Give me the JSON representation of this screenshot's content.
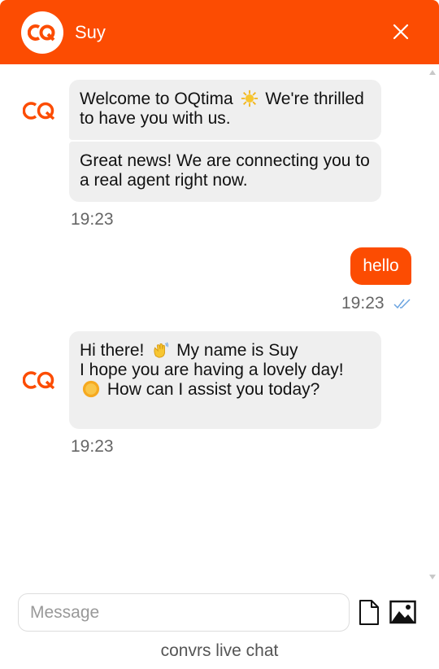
{
  "header": {
    "agent_name": "Suy",
    "brand_color": "#fc4c02"
  },
  "messages": {
    "m1": {
      "pre": "Welcome to OQtima",
      "post": "We're thrilled to have you with us."
    },
    "m2": {
      "text": "Great news! We are connecting you to a real agent right now."
    },
    "t1": "19:23",
    "user_msg": "hello",
    "t2": "19:23",
    "m3": {
      "a": "Hi there!",
      "b": "My name is Suy",
      "c": "I hope you are having a lovely day!",
      "d": "How can I assist you today?"
    },
    "t3": "19:23"
  },
  "composer": {
    "placeholder": "Message"
  },
  "footer": {
    "text": "convrs live chat"
  },
  "icons": [
    "close-icon",
    "sun-emoji-icon",
    "waving-hand-emoji-icon",
    "file-icon",
    "image-icon",
    "double-check-icon"
  ]
}
